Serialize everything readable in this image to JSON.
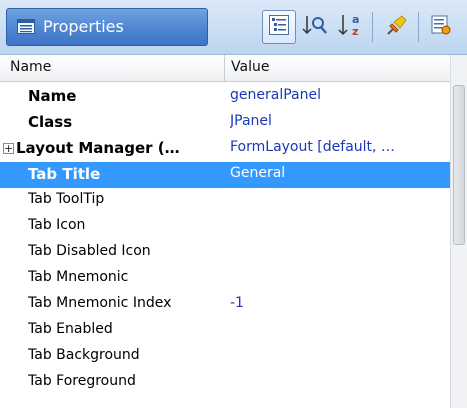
{
  "panel": {
    "title": "Properties"
  },
  "toolbar": {
    "buttons": [
      {
        "name": "categorized-view-icon",
        "active": true
      },
      {
        "name": "sort-up-icon"
      },
      {
        "name": "sort-alpha-icon"
      },
      {
        "name": "pin-icon"
      },
      {
        "name": "customize-icon"
      }
    ]
  },
  "table": {
    "headers": {
      "name": "Name",
      "value": "Value"
    },
    "rows": [
      {
        "name": "Name",
        "value": "generalPanel",
        "bold": true
      },
      {
        "name": "Class",
        "value": "JPanel",
        "bold": true
      },
      {
        "name": "Layout Manager (…",
        "value": "FormLayout [default, …",
        "bold": true,
        "expandable": true
      },
      {
        "name": "Tab Title",
        "value": "General",
        "bold": true,
        "selected": true
      },
      {
        "name": "Tab ToolTip",
        "value": ""
      },
      {
        "name": "Tab Icon",
        "value": ""
      },
      {
        "name": "Tab Disabled Icon",
        "value": ""
      },
      {
        "name": "Tab Mnemonic",
        "value": ""
      },
      {
        "name": "Tab Mnemonic Index",
        "value": "-1"
      },
      {
        "name": "Tab Enabled",
        "value": "true",
        "checkbox": true,
        "checked": true
      },
      {
        "name": "Tab Background",
        "value": ""
      },
      {
        "name": "Tab Foreground",
        "value": ""
      }
    ]
  },
  "colors": {
    "selection": "#3399ff",
    "value_text": "#1a38b8",
    "title_tab": "#4f86d3"
  }
}
